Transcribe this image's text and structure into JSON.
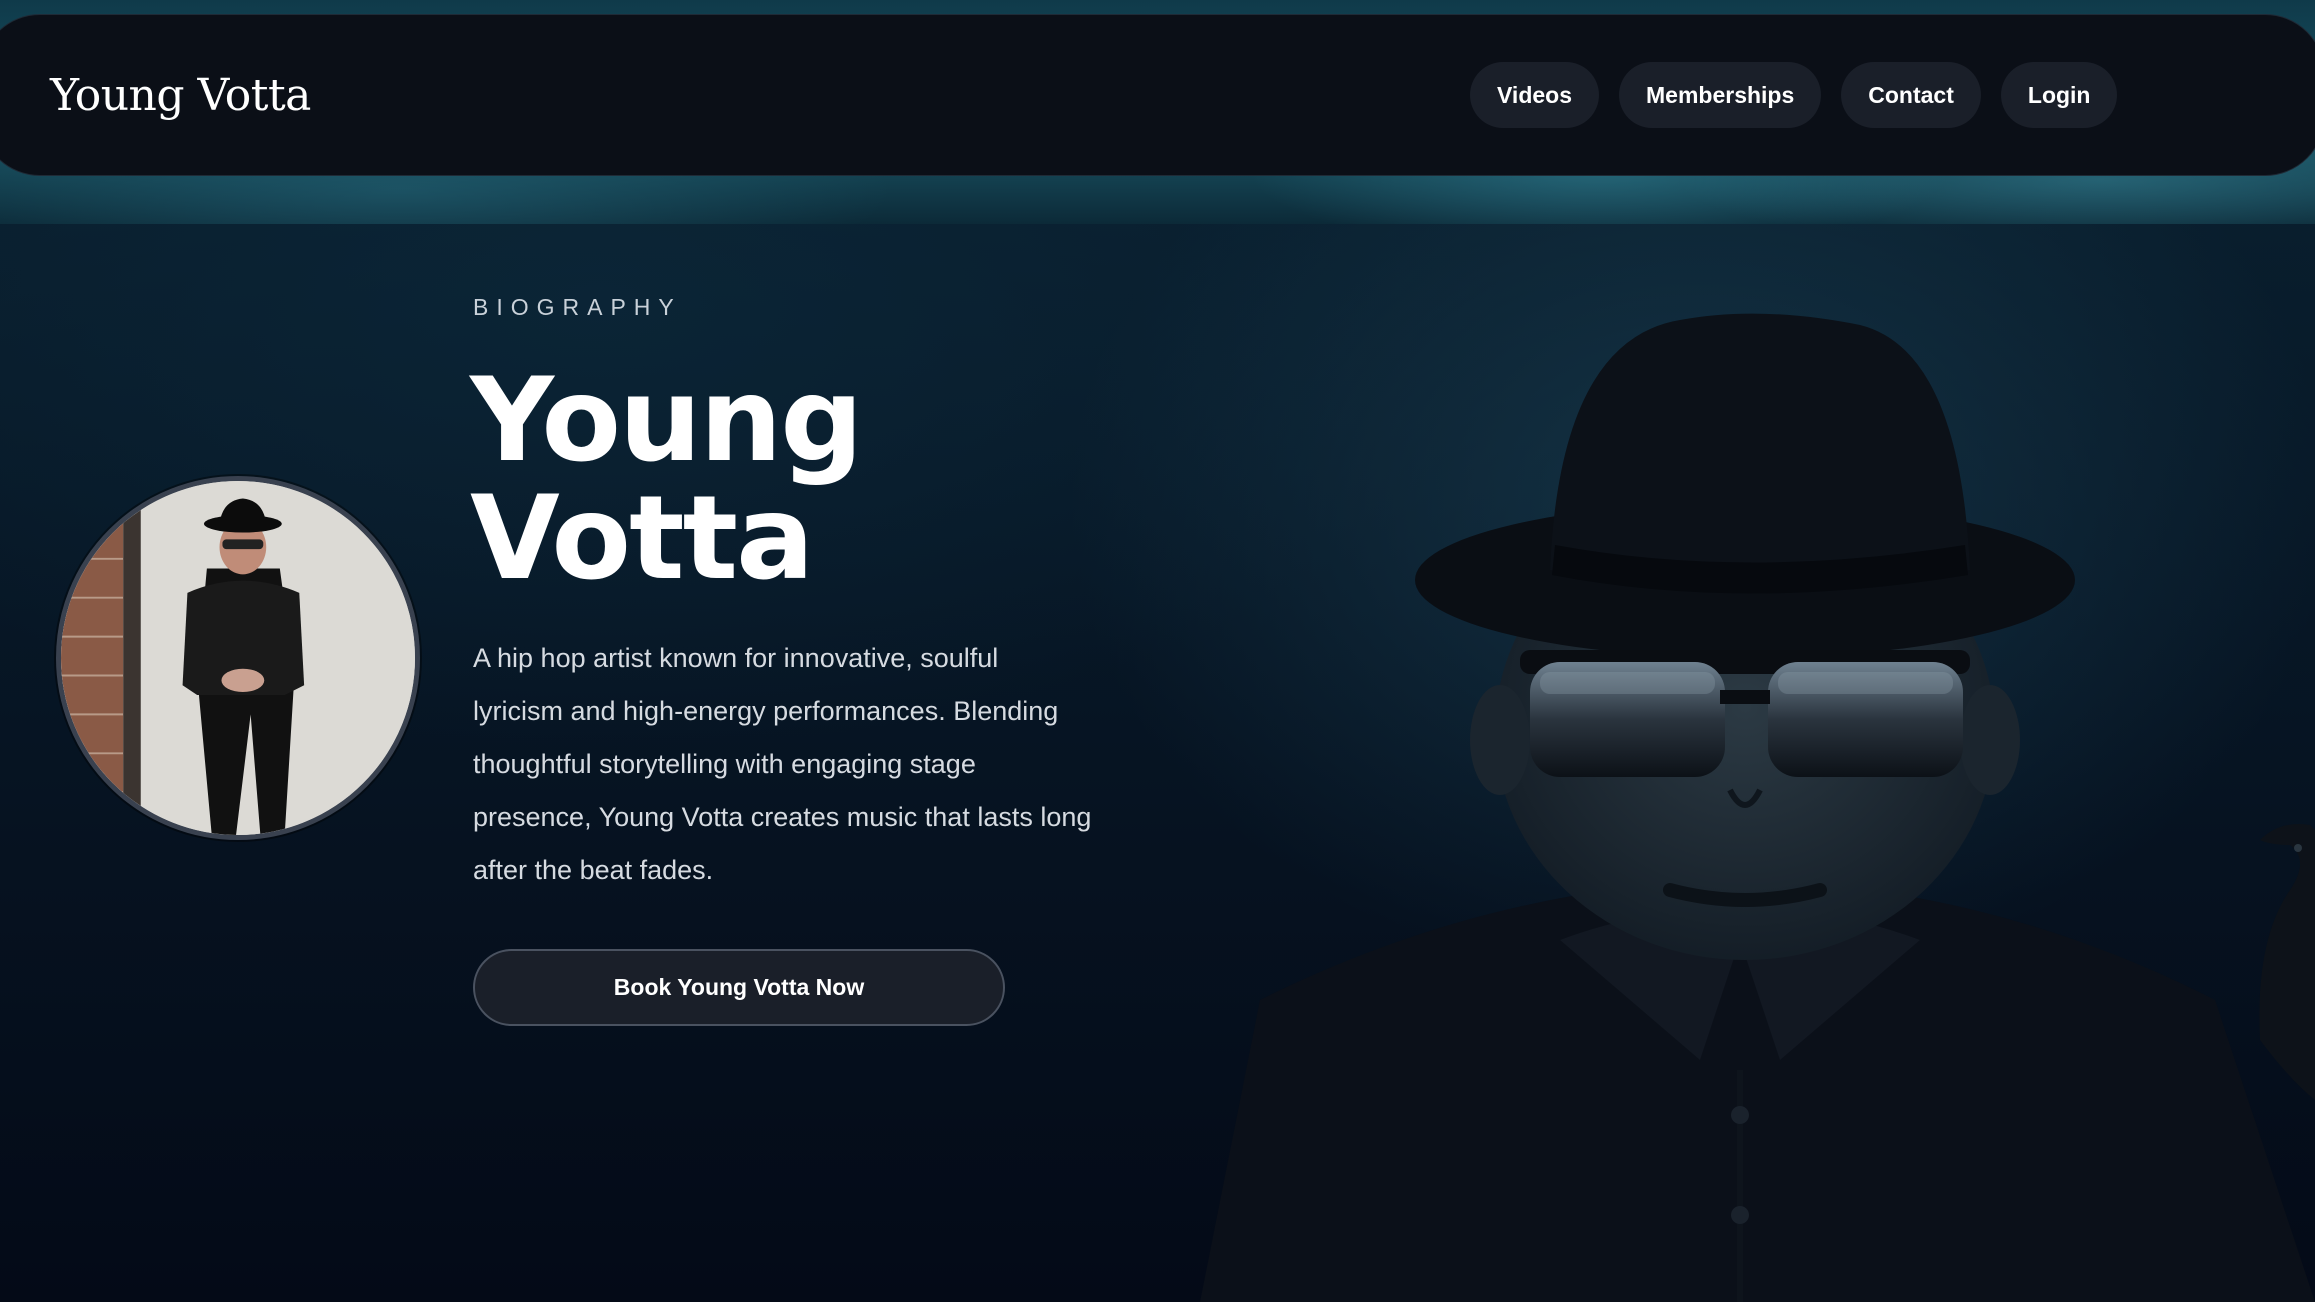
{
  "header": {
    "logo": "Young Votta",
    "nav": [
      {
        "label": "Videos"
      },
      {
        "label": "Memberships"
      },
      {
        "label": "Contact"
      },
      {
        "label": "Login"
      }
    ]
  },
  "hero": {
    "eyebrow": "BIOGRAPHY",
    "title_line1": "Young",
    "title_line2": "Votta",
    "bio": "A hip hop artist known for innovative, soulful lyricism and high-energy performances. Blending thoughtful storytelling with engaging stage presence, Young Votta creates music that lasts long after the beat fades.",
    "cta_label": "Book Young Votta Now"
  },
  "colors": {
    "page_background": "#050d1a",
    "nav_background": "#0b0f17",
    "button_background": "#1a1f29",
    "text": "#ffffff"
  }
}
